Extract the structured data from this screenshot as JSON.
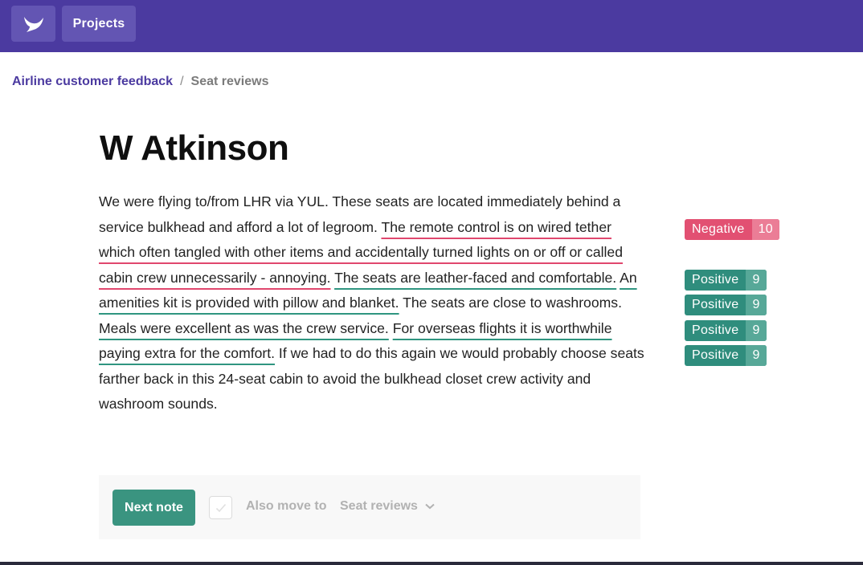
{
  "header": {
    "logo_icon": "bird-logo-icon",
    "projects_label": "Projects",
    "bg_color": "#4b3aa0"
  },
  "breadcrumb": {
    "parent": "Airline customer feedback",
    "separator": "/",
    "current": "Seat reviews"
  },
  "note": {
    "title": "W Atkinson",
    "segments": [
      {
        "text": "We were flying to/from LHR via YUL. These seats are located immediately behind a service bulkhead and afford a lot of legroom. ",
        "highlight": null
      },
      {
        "text": "The remote control is on wired tether which often tangled with other items and accidentally turned lights on or off or called cabin crew unnecessarily - annoying.",
        "highlight": "negative"
      },
      {
        "text": " ",
        "highlight": null
      },
      {
        "text": "The seats are leather-faced and comfortable.",
        "highlight": "positive"
      },
      {
        "text": " ",
        "highlight": null
      },
      {
        "text": "An amenities kit is provided with pillow and blanket.",
        "highlight": "positive"
      },
      {
        "text": " The seats are close to washrooms. ",
        "highlight": null
      },
      {
        "text": "Meals were excellent as was the crew service.",
        "highlight": "positive"
      },
      {
        "text": " ",
        "highlight": null
      },
      {
        "text": "For overseas flights it is worthwhile paying extra for the comfort.",
        "highlight": "positive"
      },
      {
        "text": " If we had to do this again we would probably choose seats farther back in this 24-seat cabin to avoid the bulkhead closet crew activity and washroom sounds.",
        "highlight": null
      }
    ]
  },
  "tags": [
    {
      "label": "Negative",
      "count": "10",
      "kind": "negative"
    },
    {
      "label": "Positive",
      "count": "9",
      "kind": "positive"
    },
    {
      "label": "Positive",
      "count": "9",
      "kind": "positive"
    },
    {
      "label": "Positive",
      "count": "9",
      "kind": "positive"
    },
    {
      "label": "Positive",
      "count": "9",
      "kind": "positive"
    }
  ],
  "footer": {
    "next_label": "Next note",
    "checkbox_checked": false,
    "also_move_label": "Also move to",
    "destination": "Seat reviews"
  },
  "colors": {
    "accent": "#4b3aa0",
    "negative": "#e25072",
    "positive": "#2f8d7d",
    "button": "#3a9480"
  }
}
